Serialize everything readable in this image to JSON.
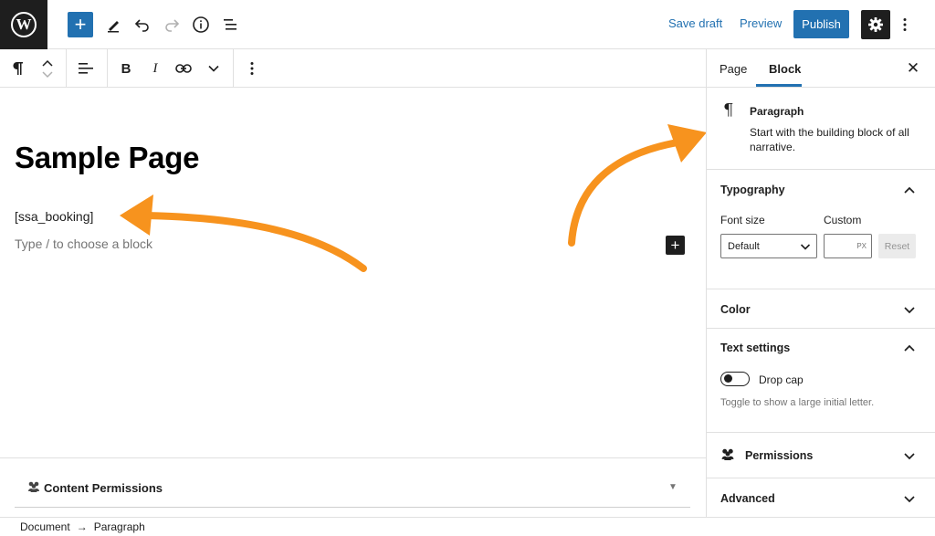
{
  "topbar": {
    "logo_letter": "W",
    "save_draft": "Save draft",
    "preview": "Preview",
    "publish": "Publish"
  },
  "editor": {
    "title": "Sample Page",
    "shortcode": "[ssa_booking]",
    "placeholder": "Type / to choose a block"
  },
  "content_permissions": {
    "title": "Content Permissions"
  },
  "statusbar": {
    "breadcrumb": [
      "Document",
      "Paragraph"
    ],
    "separator": "→"
  },
  "sidebar": {
    "tabs": [
      "Page",
      "Block"
    ],
    "active_tab": "Block",
    "block": {
      "name": "Paragraph",
      "description": "Start with the building block of all narrative."
    },
    "typography": {
      "title": "Typography",
      "font_size_label": "Font size",
      "custom_label": "Custom",
      "font_size_value": "Default",
      "unit": "PX",
      "reset": "Reset"
    },
    "color": {
      "title": "Color"
    },
    "text_settings": {
      "title": "Text settings",
      "drop_cap_label": "Drop cap",
      "drop_cap_help": "Toggle to show a large initial letter.",
      "drop_cap_on": false
    },
    "permissions": {
      "title": "Permissions"
    },
    "advanced": {
      "title": "Advanced"
    }
  },
  "colors": {
    "accent": "#2271b1",
    "dark": "#1e1e1e",
    "annotation_arrow": "#f7931e"
  }
}
